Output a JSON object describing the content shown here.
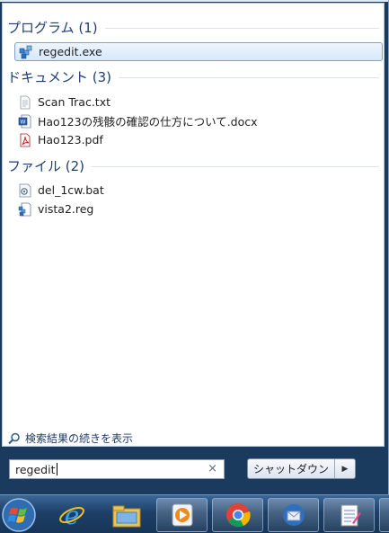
{
  "groups": [
    {
      "title": "プログラム (1)",
      "items": [
        {
          "label": "regedit.exe",
          "icon": "regedit-icon"
        }
      ]
    },
    {
      "title": "ドキュメント (3)",
      "items": [
        {
          "label": "Scan Trac.txt",
          "icon": "text-file-icon"
        },
        {
          "label": "Hao123の残骸の確認の仕方について.docx",
          "icon": "word-document-icon"
        },
        {
          "label": "Hao123.pdf",
          "icon": "pdf-file-icon"
        }
      ]
    },
    {
      "title": "ファイル (2)",
      "items": [
        {
          "label": "del_1cw.bat",
          "icon": "batch-file-icon"
        },
        {
          "label": "vista2.reg",
          "icon": "registry-file-icon"
        }
      ]
    }
  ],
  "see_more": "検索結果の続きを表示",
  "search": {
    "value": "regedit",
    "clear": "×"
  },
  "shutdown": {
    "label": "シャットダウン",
    "arrow": "▶"
  },
  "taskbar": [
    "start-orb",
    "internet-explorer-icon",
    "file-explorer-icon",
    "media-player-icon",
    "chrome-icon",
    "thunderbird-icon",
    "notepad-icon"
  ],
  "colors": {
    "header": "#1f3f73",
    "selection_border": "#7da2ce",
    "taskbar": "#1d4068"
  }
}
